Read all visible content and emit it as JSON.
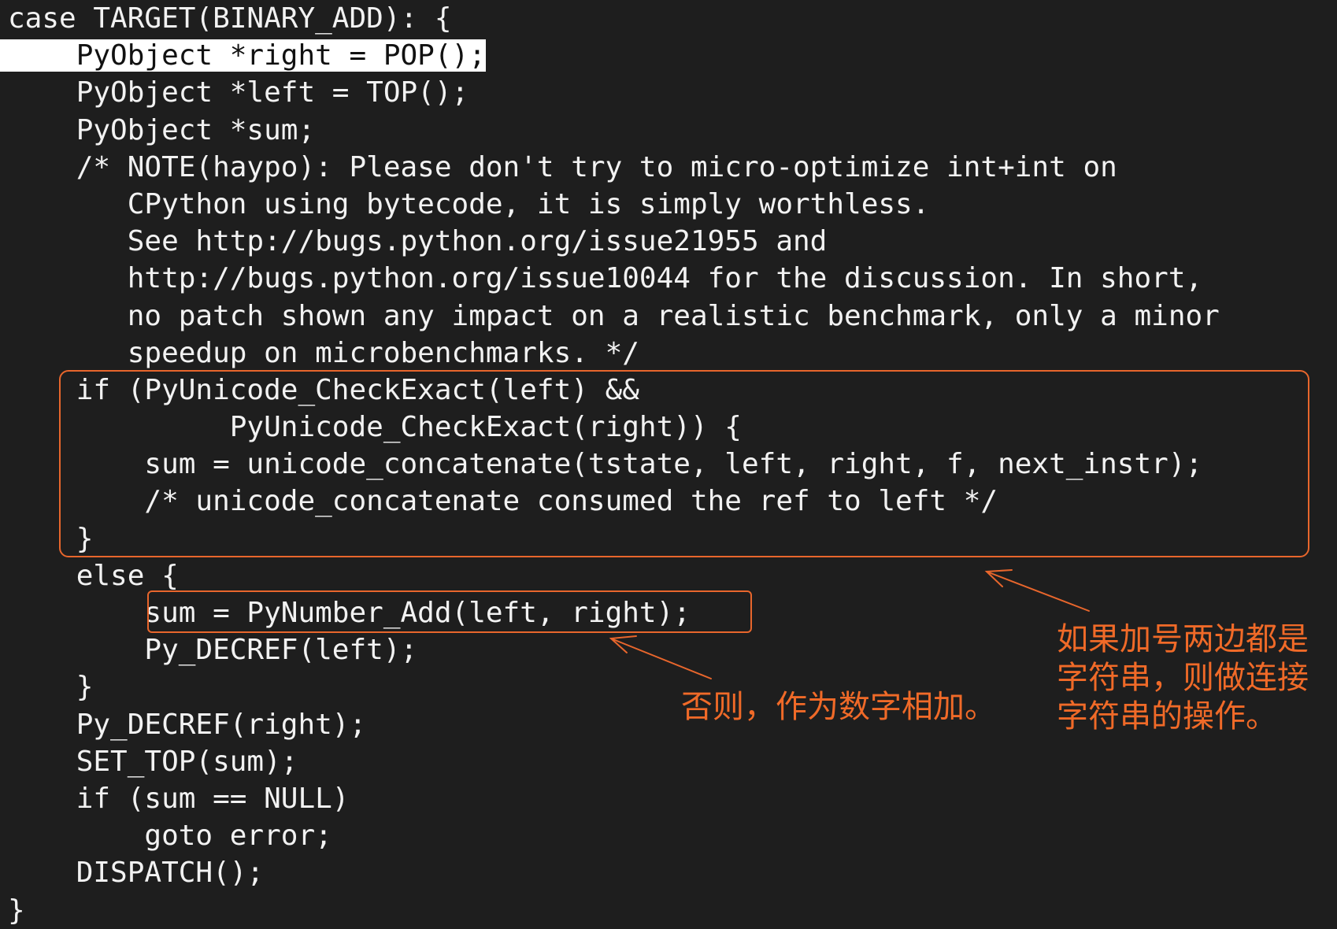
{
  "code": {
    "lines": [
      "case TARGET(BINARY_ADD): {",
      "    PyObject *right = POP();",
      "    PyObject *left = TOP();",
      "    PyObject *sum;",
      "    /* NOTE(haypo): Please don't try to micro-optimize int+int on",
      "       CPython using bytecode, it is simply worthless.",
      "       See http://bugs.python.org/issue21955 and",
      "       http://bugs.python.org/issue10044 for the discussion. In short,",
      "       no patch shown any impact on a realistic benchmark, only a minor",
      "       speedup on microbenchmarks. */",
      "    if (PyUnicode_CheckExact(left) &&",
      "             PyUnicode_CheckExact(right)) {",
      "        sum = unicode_concatenate(tstate, left, right, f, next_instr);",
      "        /* unicode_concatenate consumed the ref to left */",
      "    }",
      "    else {",
      "        sum = PyNumber_Add(left, right);",
      "        Py_DECREF(left);",
      "    }",
      "    Py_DECREF(right);",
      "    SET_TOP(sum);",
      "    if (sum == NULL)",
      "        goto error;",
      "    DISPATCH();",
      "}"
    ],
    "highlighted_line": 1
  },
  "annotations": {
    "else_note": "否则，作为数字相加。",
    "if_note": "如果加号两边都是\n字符串，则做连接\n字符串的操作。"
  },
  "colors": {
    "background": "#1e1e1e",
    "text": "#f2f2f2",
    "annotation": "#f06a28",
    "highlight": "#ffffff"
  }
}
